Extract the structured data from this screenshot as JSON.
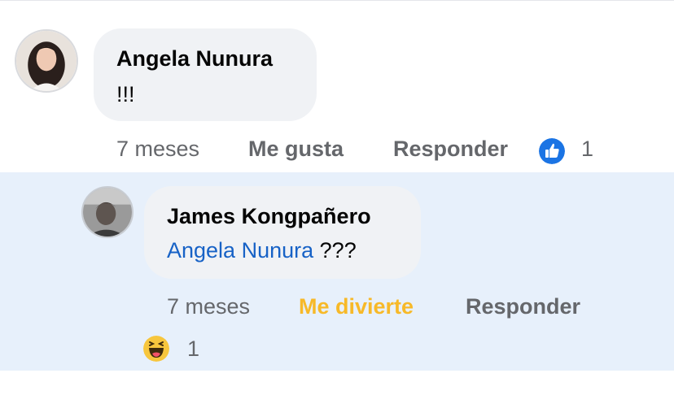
{
  "comment": {
    "author": "Angela Nunura",
    "text": "!!!",
    "time": "7 meses",
    "like_label": "Me gusta",
    "reply_label": "Responder",
    "reaction_icon": "like-icon",
    "reaction_count": "1"
  },
  "reply": {
    "author": "James Kongpañero",
    "mention": "Angela Nunura",
    "text": "???",
    "time": "7 meses",
    "reaction_label": "Me divierte",
    "reply_label": "Responder",
    "reaction_icon": "haha-emoji-icon",
    "reaction_count": "1"
  },
  "colors": {
    "reply_background": "#e7f0fb",
    "bubble": "#f0f2f5",
    "mention": "#1762c6",
    "like_reaction": "#1b74e4",
    "haha_label": "#f7b928"
  }
}
